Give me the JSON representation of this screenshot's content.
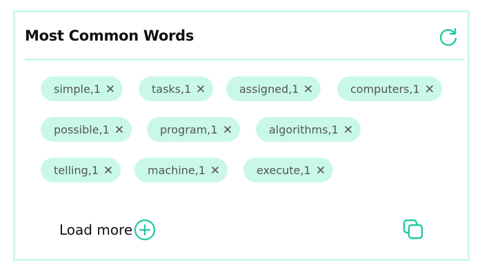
{
  "card": {
    "title": "Most Common Words",
    "refresh_icon": "refresh-icon",
    "accent_color": "#1ec9a5",
    "chip_color": "#c9f8ea",
    "border_color": "#cdf7ea"
  },
  "chips": [
    {
      "label": "simple,1"
    },
    {
      "label": "tasks,1"
    },
    {
      "label": "assigned,1"
    },
    {
      "label": "computers,1"
    },
    {
      "label": "possible,1"
    },
    {
      "label": "program,1"
    },
    {
      "label": "algorithms,1"
    },
    {
      "label": "telling,1"
    },
    {
      "label": "machine,1"
    },
    {
      "label": "execute,1"
    }
  ],
  "footer": {
    "load_more_label": "Load more",
    "plus_icon": "plus-circle-icon",
    "copy_icon": "copy-icon"
  }
}
